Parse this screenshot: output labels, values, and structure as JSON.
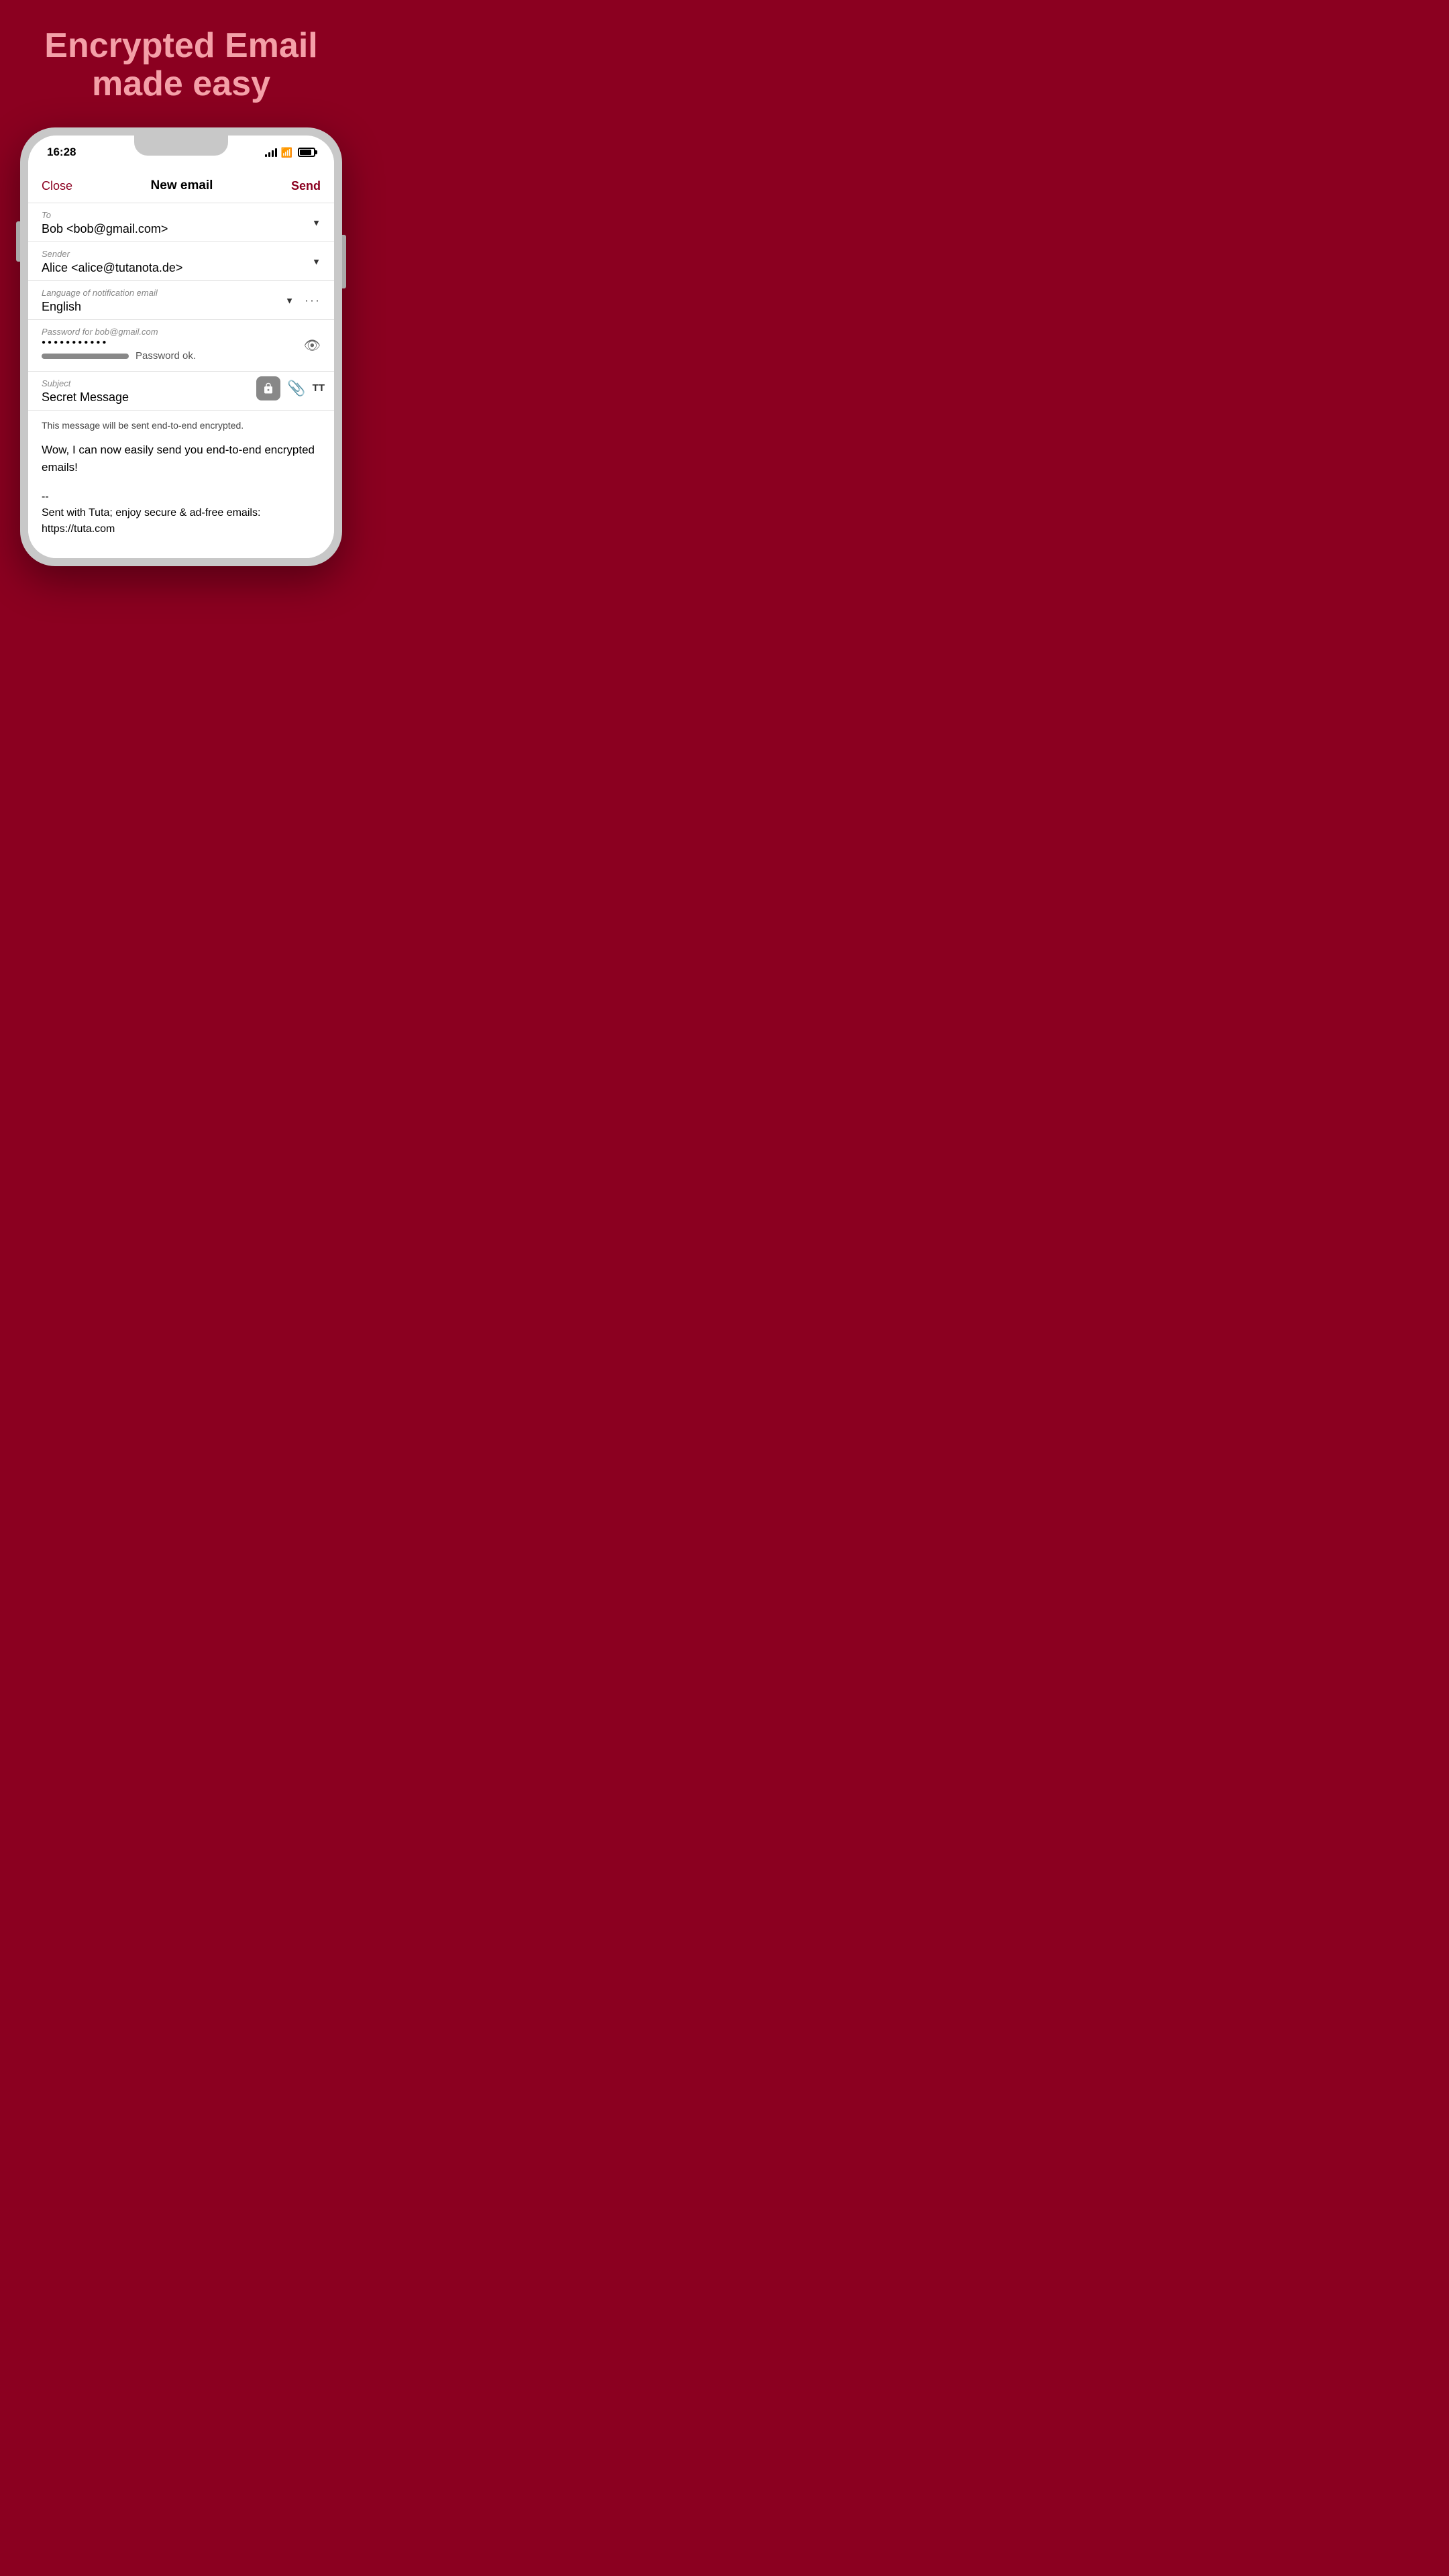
{
  "hero": {
    "line1": "Encrypted Email",
    "line2": "made easy"
  },
  "statusBar": {
    "time": "16:28",
    "signal": "signal",
    "wifi": "wifi",
    "battery": "battery"
  },
  "composeHeader": {
    "close": "Close",
    "title": "New email",
    "send": "Send"
  },
  "fields": {
    "toLabel": "To",
    "toValue": "Bob <bob@gmail.com>",
    "senderLabel": "Sender",
    "senderValue": "Alice <alice@tutanota.de>",
    "langLabel": "Language of notification email",
    "langValue": "English",
    "passwordLabel": "Password for bob@gmail.com",
    "passwordValue": "●●●●●●●●●●●",
    "passwordStatus": "Password ok.",
    "subjectLabel": "Subject",
    "subjectValue": "Secret Message",
    "encryptedNotice": "This message will be sent end-to-end encrypted.",
    "bodyText": "Wow, I can now easily send you end-to-end encrypted emails!",
    "signature": "--\nSent with Tuta; enjoy secure & ad-free emails:\nhttps://tuta.com"
  }
}
